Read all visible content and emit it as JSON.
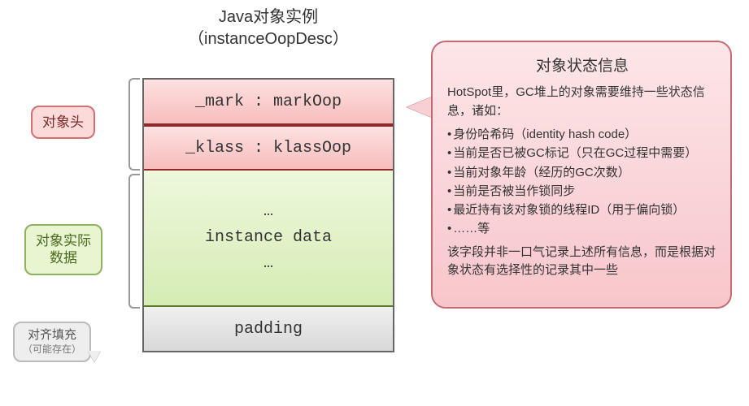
{
  "title": {
    "line1": "Java对象实例",
    "line2": "（instanceOopDesc）"
  },
  "rows": {
    "mark": "_mark : markOop",
    "klass": "_klass : klassOop",
    "data_dots_top": "…",
    "data_label": "instance data",
    "data_dots_bottom": "…",
    "padding": "padding"
  },
  "labels": {
    "header": "对象头",
    "body": "对象实际\n数据",
    "pad": "对齐填充",
    "pad_sub": "（可能存在）"
  },
  "callout": {
    "title": "对象状态信息",
    "intro": "HotSpot里，GC堆上的对象需要维持一些状态信息，诸如：",
    "bullets": [
      "身份哈希码（identity hash code）",
      "当前是否已被GC标记（只在GC过程中需要）",
      "当前对象年龄（经历的GC次数）",
      "当前是否被当作锁同步",
      "最近持有该对象锁的线程ID（用于偏向锁）",
      "……等"
    ],
    "outro": "该字段并非一口气记录上述所有信息，而是根据对象状态有选择性的记录其中一些"
  }
}
